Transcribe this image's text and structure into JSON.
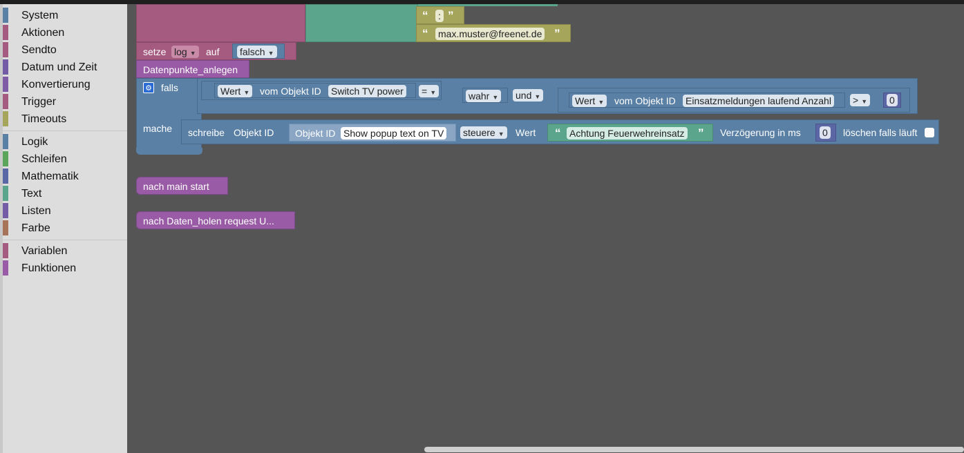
{
  "toolbox": {
    "groups": [
      [
        {
          "label": "System",
          "color": "#5b80a5"
        },
        {
          "label": "Aktionen",
          "color": "#a55b80"
        },
        {
          "label": "Sendto",
          "color": "#a55b80"
        },
        {
          "label": "Datum und Zeit",
          "color": "#745ba5"
        },
        {
          "label": "Konvertierung",
          "color": "#7d5ba5"
        },
        {
          "label": "Trigger",
          "color": "#a55b80"
        },
        {
          "label": "Timeouts",
          "color": "#a5a55b"
        }
      ],
      [
        {
          "label": "Logik",
          "color": "#5b80a5"
        },
        {
          "label": "Schleifen",
          "color": "#5ba55b"
        },
        {
          "label": "Mathematik",
          "color": "#5b67a5"
        },
        {
          "label": "Text",
          "color": "#5ba58c"
        },
        {
          "label": "Listen",
          "color": "#745ba5"
        },
        {
          "label": "Farbe",
          "color": "#a5745b"
        }
      ],
      [
        {
          "label": "Variablen",
          "color": "#a55b80"
        },
        {
          "label": "Funktionen",
          "color": "#995ba5"
        }
      ]
    ]
  },
  "colors": {
    "workspace": "#555555",
    "variable": "#a55b80",
    "text": "#5ba58c",
    "logic": "#5b80a5",
    "function": "#995ba5",
    "text_join": "#a5a55b"
  },
  "workspace": {
    "text_top": ":",
    "email": "max.muster@freenet.de",
    "setze": {
      "label": "setze",
      "var": "log",
      "auf": "auf",
      "value": "falsch"
    },
    "func_call": "Datenpunkte_anlegen",
    "if_block": {
      "falls": "falls",
      "mache": "mache",
      "cond1": {
        "prop": "Wert",
        "vom": "vom Objekt ID",
        "obj": "Switch TV power",
        "op": "=",
        "value": "wahr"
      },
      "und": "und",
      "cond2": {
        "prop": "Wert",
        "vom": "vom Objekt ID",
        "obj": "Einsatzmeldungen laufend Anzahl",
        "op": ">",
        "value": "0"
      },
      "write": {
        "schreibe": "schreibe",
        "objekt_id": "Objekt ID",
        "obj_label": "Objekt ID",
        "obj": "Show popup text on TV",
        "mode": "steuere",
        "wert": "Wert",
        "text": "Achtung Feuerwehreinsatz",
        "delay_label": "Verzögerung in ms",
        "delay": "0",
        "clear_label": "löschen falls läuft"
      }
    },
    "call_main": "nach main  start",
    "call_daten": "nach Daten_holen  request U..."
  }
}
